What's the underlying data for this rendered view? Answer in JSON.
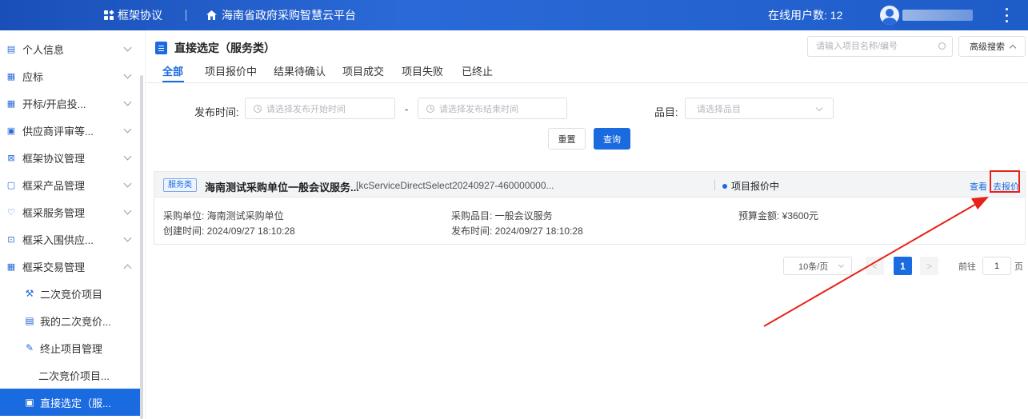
{
  "topbar": {
    "brand": "框架协议",
    "platform": "海南省政府采购智慧云平台",
    "online_users": "在线用户数: 12"
  },
  "sidebar": {
    "items": [
      {
        "label": "个人信息",
        "icon": "person-card-icon"
      },
      {
        "label": "应标",
        "icon": "document-icon"
      },
      {
        "label": "开标/开启投...",
        "icon": "document-icon"
      },
      {
        "label": "供应商评审等...",
        "icon": "monitor-icon"
      },
      {
        "label": "框架协议管理",
        "icon": "agreement-icon"
      },
      {
        "label": "框采产品管理",
        "icon": "product-icon"
      },
      {
        "label": "框采服务管理",
        "icon": "service-icon"
      },
      {
        "label": "框采入围供应...",
        "icon": "supplier-icon"
      },
      {
        "label": "框采交易管理",
        "icon": "trade-icon"
      }
    ],
    "sub_items": [
      {
        "label": "二次竞价项目",
        "icon": "hammer-icon"
      },
      {
        "label": "我的二次竞价...",
        "icon": "person-card-icon"
      },
      {
        "label": "终止项目管理",
        "icon": "edit-doc-icon"
      },
      {
        "label": "二次竞价项目...",
        "icon": ""
      },
      {
        "label": "直接选定（服...",
        "icon": "direct-select-icon"
      }
    ]
  },
  "main": {
    "title": "直接选定（服务类）",
    "search_placeholder": "请输入项目名称/编号",
    "advanced_search": "高级搜索",
    "tabs": [
      "全部",
      "项目报价中",
      "结果待确认",
      "项目成交",
      "项目失败",
      "已终止"
    ],
    "filters": {
      "publish_time_label": "发布时间:",
      "start_placeholder": "请选择发布开始时间",
      "dash": "-",
      "end_placeholder": "请选择发布结束时间",
      "category_label": "品目:",
      "category_placeholder": "请选择品目",
      "reset": "重置",
      "query": "查询"
    },
    "card": {
      "badge": "服务类",
      "title": "海南测试采购单位一般会议服务...",
      "code": "[kcServiceDirectSelect20240927-460000000...",
      "status": "项目报价中",
      "view": "查看",
      "quote": "去报价",
      "purchaser": "采购单位: 海南测试采购单位",
      "created": "创建时间: 2024/09/27 18:10:28",
      "category": "采购品目: 一般会议服务",
      "published": "发布时间: 2024/09/27 18:10:28",
      "budget": "预算金额: ¥3600元"
    },
    "pager": {
      "page_size": "10条/页",
      "prev": "<",
      "current": "1",
      "next": ">",
      "goto": "前往",
      "goto_value": "1",
      "unit": "页"
    }
  },
  "colors": {
    "accent": "#1a6ae0",
    "annotation": "#e8221b"
  }
}
